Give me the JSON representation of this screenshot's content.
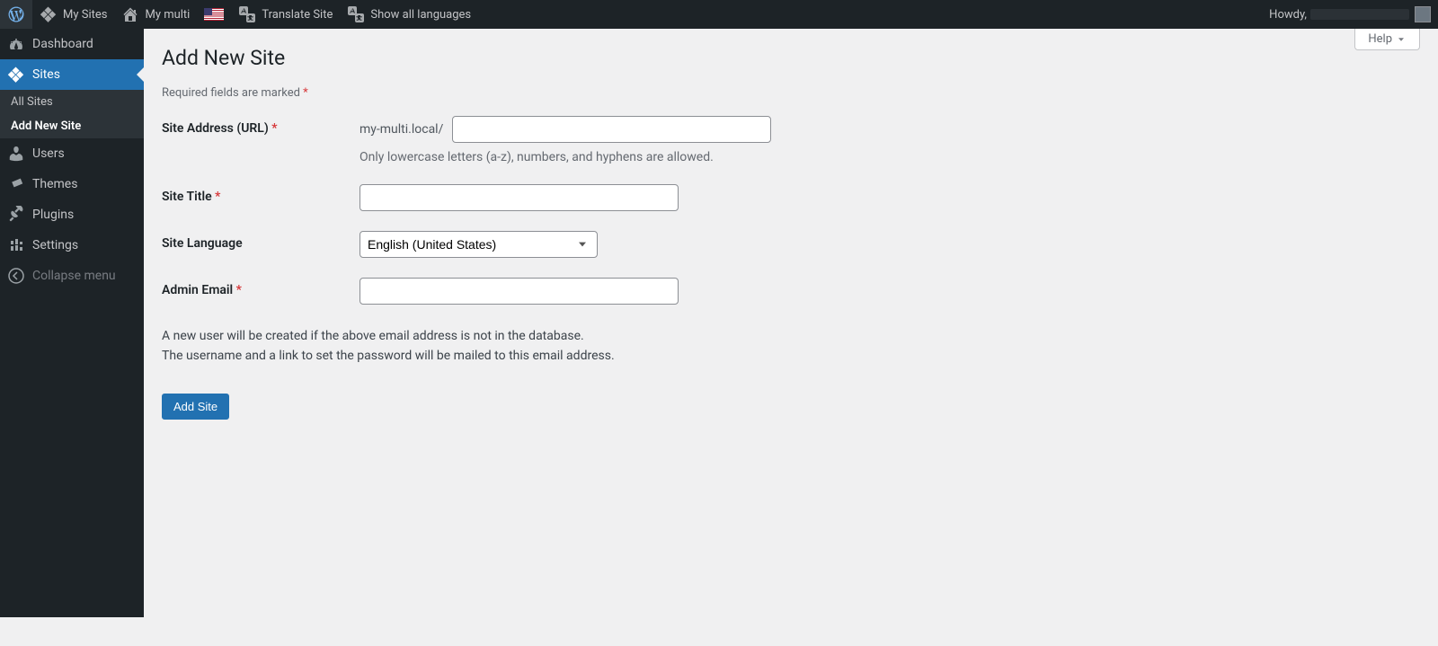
{
  "adminbar": {
    "my_sites": "My Sites",
    "current_site": "My multi",
    "translate_site": "Translate Site",
    "show_all_languages": "Show all languages",
    "howdy": "Howdy,"
  },
  "menu": {
    "dashboard": "Dashboard",
    "sites": "Sites",
    "users": "Users",
    "themes": "Themes",
    "plugins": "Plugins",
    "settings": "Settings",
    "collapse": "Collapse menu",
    "submenu": {
      "all_sites": "All Sites",
      "add_new": "Add New Site"
    }
  },
  "screen": {
    "help": "Help",
    "title": "Add New Site",
    "required_note": "Required fields are marked ",
    "star": "*"
  },
  "form": {
    "site_address_label": "Site Address (URL) ",
    "site_address_prefix": "my-multi.local/",
    "site_address_desc": "Only lowercase letters (a-z), numbers, and hyphens are allowed.",
    "site_title_label": "Site Title ",
    "site_language_label": "Site Language",
    "site_language_value": "English (United States)",
    "admin_email_label": "Admin Email ",
    "info_line1": "A new user will be created if the above email address is not in the database.",
    "info_line2": "The username and a link to set the password will be mailed to this email address.",
    "submit": "Add Site"
  }
}
